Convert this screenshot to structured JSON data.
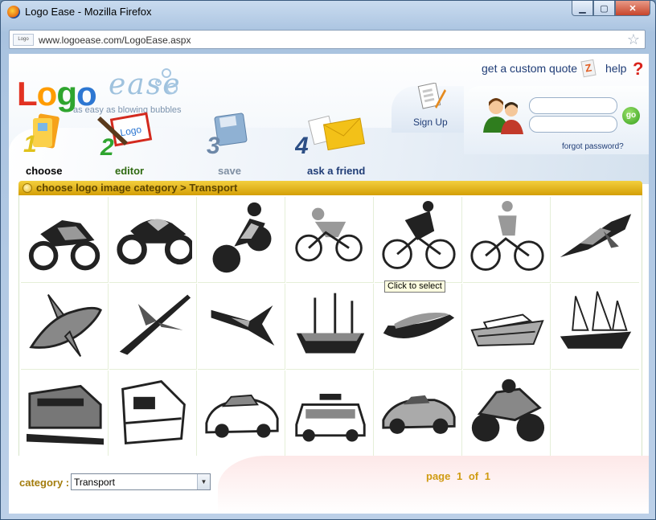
{
  "window": {
    "title": "Logo Ease - Mozilla Firefox",
    "controls": {
      "minimize": "▁",
      "maximize": "▢",
      "close": "✕"
    }
  },
  "browser": {
    "url": "www.logoease.com/LogoEase.aspx",
    "site_icon_text": "Logo"
  },
  "header": {
    "logo_part1": "Logo",
    "logo_part2": "ease",
    "tagline": "as easy as blowing bubbles",
    "quote_link": "get a custom quote",
    "help_link": "help",
    "signup_label": "Sign Up",
    "forgot_password": "forgot password?",
    "go_label": "go"
  },
  "steps": [
    {
      "number": "1",
      "label": "choose",
      "color": "#c9a112",
      "active": true
    },
    {
      "number": "2",
      "label": "editor",
      "color": "#2f6a11"
    },
    {
      "number": "3",
      "label": "save",
      "color": "#7f8fa2"
    },
    {
      "number": "4",
      "label": "ask a friend",
      "color": "#1f3c76"
    }
  ],
  "category_bar": {
    "text": "choose logo image category > Transport"
  },
  "images": [
    {
      "icon": "sport-motorcycle-icon"
    },
    {
      "icon": "cruiser-motorcycle-icon"
    },
    {
      "icon": "motorcycle-rider-icon"
    },
    {
      "icon": "cyclist-icon"
    },
    {
      "icon": "road-cyclist-icon"
    },
    {
      "icon": "bicycle-rider-icon"
    },
    {
      "icon": "jet-plane-icon"
    },
    {
      "icon": "cartoon-airplane-icon"
    },
    {
      "icon": "airliner-icon"
    },
    {
      "icon": "fighter-jet-icon"
    },
    {
      "icon": "sailing-ship-icon"
    },
    {
      "icon": "speedboat-icon"
    },
    {
      "icon": "cruise-ship-icon"
    },
    {
      "icon": "tall-ship-icon"
    },
    {
      "icon": "high-speed-train-icon"
    },
    {
      "icon": "locomotive-icon"
    },
    {
      "icon": "sports-car-icon"
    },
    {
      "icon": "police-car-icon"
    },
    {
      "icon": "coupe-car-icon"
    },
    {
      "icon": "motorcycle-icon"
    }
  ],
  "tooltip": "Click to select",
  "footer": {
    "category_label": "category :",
    "category_value": "Transport",
    "page_label": "page",
    "page_current": "1",
    "page_of": "of",
    "page_total": "1"
  }
}
